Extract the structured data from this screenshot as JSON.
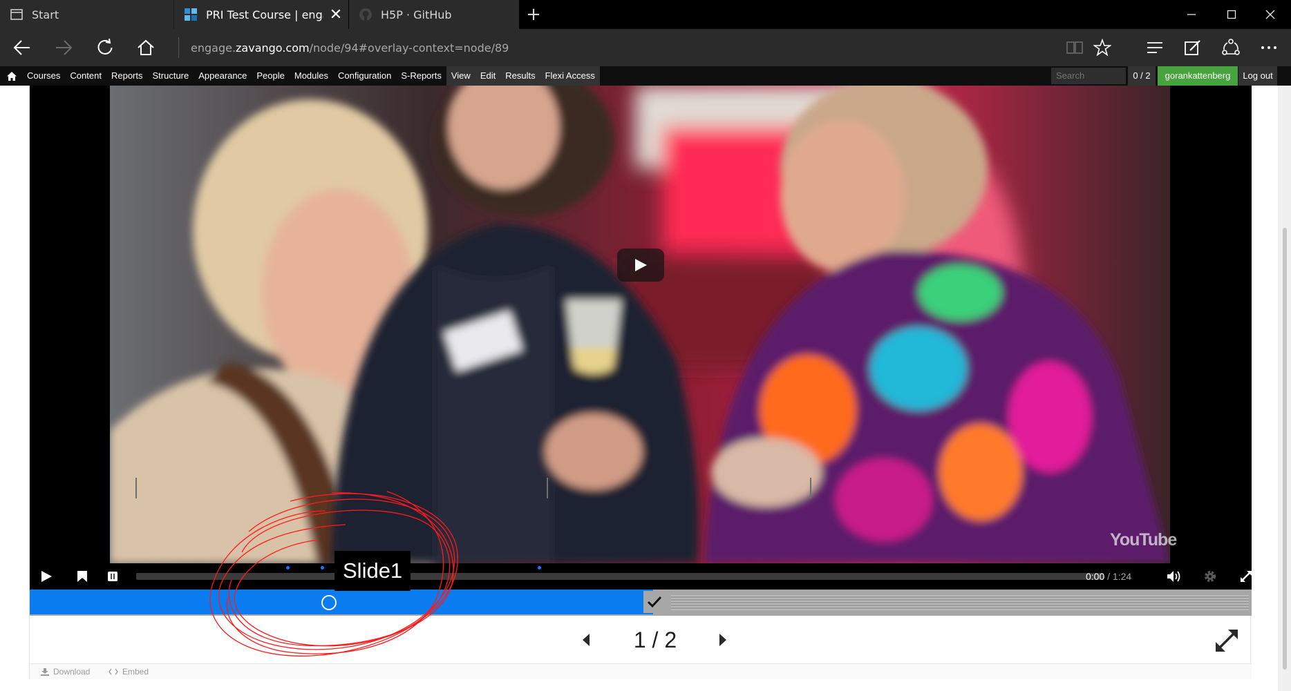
{
  "browser": {
    "tabs": [
      {
        "label": "Start",
        "icon": "window-icon"
      },
      {
        "label": "PRI Test Course | engage",
        "icon": "zavango-favicon-icon"
      },
      {
        "label": "H5P · GitHub",
        "icon": "github-favicon-icon"
      }
    ],
    "url_host_prefix": "engage.",
    "url_host_domain": "zavango.com",
    "url_path": "/node/94#overlay-context=node/89"
  },
  "admin_toolbar": {
    "menu": [
      "Courses",
      "Content",
      "Reports",
      "Structure",
      "Appearance",
      "People",
      "Modules",
      "Configuration",
      "S-Reports"
    ],
    "tabs": [
      "View",
      "Edit",
      "Results",
      "Flexi Access"
    ],
    "search_placeholder": "Search",
    "count": "0 / 2",
    "username": "gorankattenberg",
    "logout": "Log out",
    "user_color": "#47a33d"
  },
  "video": {
    "watermark": "YouTube",
    "current_time": "0:00",
    "separator": " / ",
    "duration": "1:24",
    "tooltip": "Slide1"
  },
  "slides": {
    "current": "1",
    "separator": "/",
    "total": "2",
    "progress_fraction": 0.51,
    "accent_color": "#0a7cf0"
  },
  "footer": {
    "download": "Download",
    "embed": "Embed"
  }
}
